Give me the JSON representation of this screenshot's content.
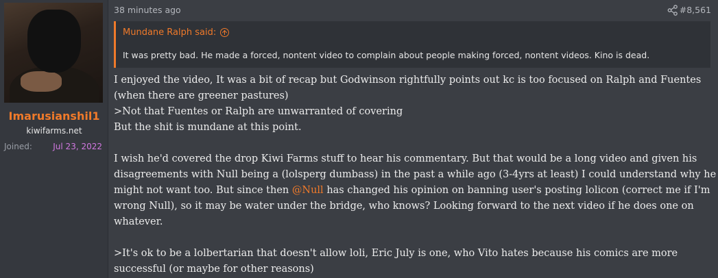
{
  "user": {
    "username": "Imarusianshil1",
    "title": "kiwifarms.net",
    "joined_label": "Joined:",
    "joined_date": "Jul 23, 2022"
  },
  "post": {
    "time": "38 minutes ago",
    "number": "#8,561",
    "quote": {
      "author": "Mundane Ralph said:",
      "text": "It was pretty bad. He made a forced, nontent video to complain about people making forced, nontent videos. Kino is dead."
    },
    "lines": [
      "I enjoyed the video, It was a bit of recap but Godwinson rightfully points out kc is too focused on Ralph and Fuentes",
      "(when there are greener pastures)",
      ">Not that Fuentes or Ralph are unwarranted of covering",
      "But the shit is mundane at this point."
    ],
    "para2": [
      "I wish he'd covered the drop Kiwi Farms stuff to hear his commentary. But that would be a long video and given his",
      "disagreements with Null being a (lolsperg dumbass) in the past a while ago (3-4yrs at least) I could understand why he",
      "might not want too. But since then",
      "has changed his opinion on banning user's posting lolicon (correct me if I'm",
      "wrong Null), so it may be water under the bridge, who knows? Looking forward to the next video if he does one on",
      "whatever."
    ],
    "mention": "@Null",
    "para3": [
      ">It's ok to be a lolbertarian that doesn't allow loli, Eric July is one, who Vito hates because his comics are more",
      "successful (or maybe for other reasons)"
    ]
  },
  "colors": {
    "accent": "#f07a2a",
    "joined_date": "#d178e0",
    "background": "#3b3e44"
  }
}
